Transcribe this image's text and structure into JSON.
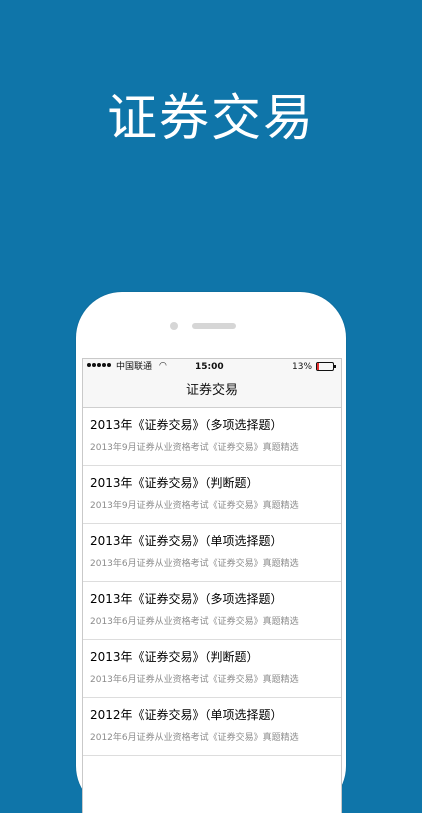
{
  "hero": {
    "title": "证券交易"
  },
  "status_bar": {
    "carrier": "中国联通",
    "time": "15:00",
    "battery_percent_text": "13%",
    "battery_level": 0.13,
    "wifi_icon": "wifi-icon"
  },
  "nav": {
    "title": "证券交易"
  },
  "list": {
    "items": [
      {
        "title": "2013年《证券交易》（多项选择题）",
        "subtitle": "2013年9月证券从业资格考试《证券交易》真题精选"
      },
      {
        "title": "2013年《证券交易》（判断题）",
        "subtitle": "2013年9月证券从业资格考试《证券交易》真题精选"
      },
      {
        "title": "2013年《证券交易》（单项选择题）",
        "subtitle": "2013年6月证券从业资格考试《证券交易》真题精选"
      },
      {
        "title": "2013年《证券交易》（多项选择题）",
        "subtitle": "2013年6月证券从业资格考试《证券交易》真题精选"
      },
      {
        "title": "2013年《证券交易》（判断题）",
        "subtitle": "2013年6月证券从业资格考试《证券交易》真题精选"
      },
      {
        "title": "2012年《证券交易》（单项选择题）",
        "subtitle": "2012年6月证券从业资格考试《证券交易》真题精选"
      }
    ]
  },
  "colors": {
    "background": "#0F75A9",
    "battery_low": "#E23030"
  }
}
